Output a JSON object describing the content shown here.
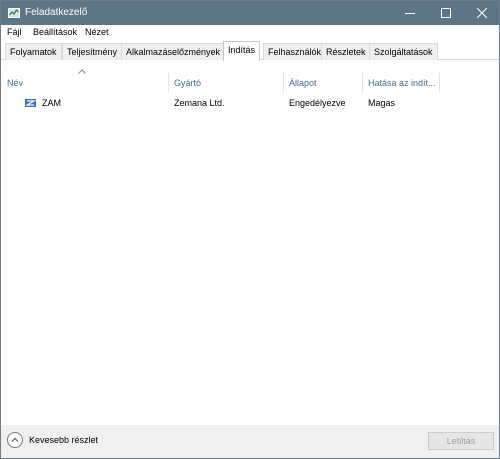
{
  "window": {
    "title": "Feladatkezelő",
    "controls": {
      "minimize": "minimize",
      "maximize": "maximize",
      "close": "close"
    }
  },
  "menu": {
    "items": [
      "Fájl",
      "Beállítások",
      "Nézet"
    ]
  },
  "tabs": {
    "items": [
      "Folyamatok",
      "Teljesítmény",
      "Alkalmazáselőzmények",
      "Indítás",
      "Felhasználók",
      "Részletek",
      "Szolgáltatások"
    ],
    "active": "Indítás"
  },
  "table": {
    "columns": [
      "Név",
      "Gyártó",
      "Állapot",
      "Hatása az indít..."
    ],
    "sorted_column": "Név",
    "sort_direction": "ascending",
    "rows": [
      {
        "name": "ZAM",
        "publisher": "Zemana Ltd.",
        "status": "Engedélyezve",
        "impact": "Magas",
        "icon": "zam-app-icon"
      }
    ]
  },
  "footer": {
    "less_details": "Kevesebb részlet",
    "disable_button": "Letiltás",
    "disable_enabled": false
  },
  "colors": {
    "titlebar": "#5e7586",
    "column_header_text": "#4a6a96",
    "footer_bg": "#f0f0f0"
  }
}
